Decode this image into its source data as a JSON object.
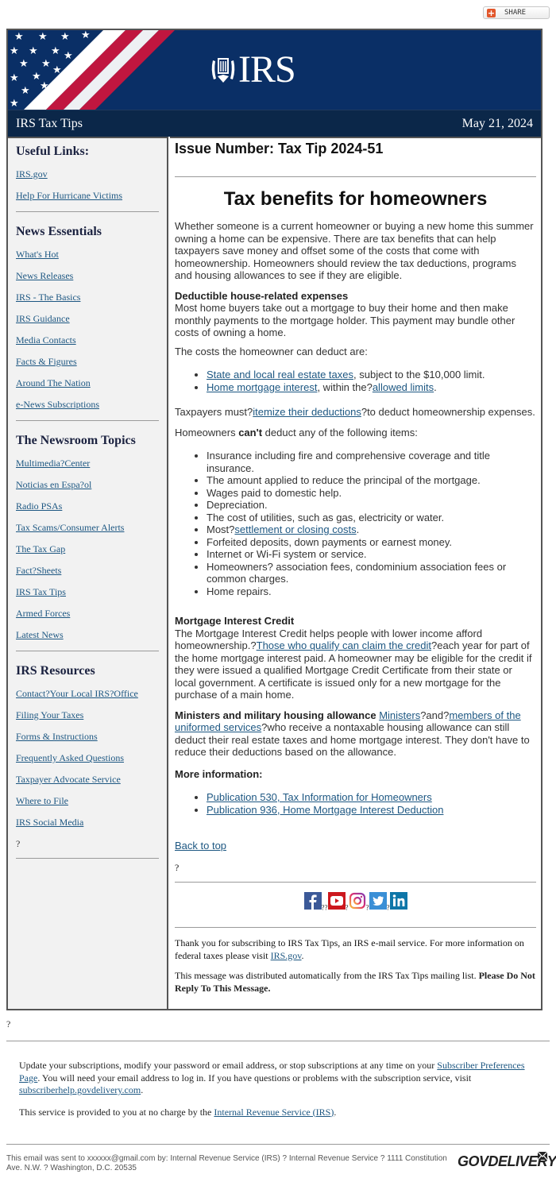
{
  "share": {
    "label": "SHARE",
    "icon": "plus-icon"
  },
  "banner": {
    "logo_text": "IRS",
    "logo_icon": "irs-eagle-seal-icon"
  },
  "titlebar": {
    "left": "IRS Tax Tips",
    "right": "May 21, 2024"
  },
  "sidebar": {
    "sections": [
      {
        "title": "Useful Links:",
        "links": [
          "IRS.gov",
          "Help For Hurricane Victims"
        ]
      },
      {
        "title": "News Essentials",
        "links": [
          "What's Hot",
          "News Releases",
          "IRS - The Basics",
          "IRS Guidance",
          "Media Contacts",
          "Facts & Figures",
          "Around The Nation",
          "e-News Subscriptions"
        ]
      },
      {
        "title": "The Newsroom Topics",
        "links": [
          "Multimedia?Center",
          "Noticias en Espa?ol",
          "Radio PSAs",
          "Tax Scams/Consumer Alerts",
          "The Tax Gap",
          "Fact?Sheets",
          "IRS Tax Tips",
          "Armed Forces",
          "Latest News"
        ]
      },
      {
        "title": "IRS Resources",
        "links": [
          "Contact?Your Local IRS?Office",
          "Filing Your Taxes",
          "Forms & Instructions",
          "Frequently Asked Questions",
          "Taxpayer Advocate Service",
          "Where to File",
          "IRS Social Media"
        ],
        "trailing": "?"
      }
    ]
  },
  "main": {
    "issue": "Issue Number: Tax Tip 2024-51",
    "headline": "Tax benefits for homeowners",
    "intro": "Whether someone is a current homeowner or buying a new home this summer owning a home can be expensive. There are tax benefits that can help taxpayers save money and offset some of the costs that come with homeownership. Homeowners should review the tax deductions, programs and housing allowances to see if they are eligible.",
    "deductible": {
      "heading": "Deductible house-related expenses",
      "body": "Most home buyers take out a mortgage to buy their home and then make monthly payments to the mortgage holder. This payment may bundle other costs of owning a home.",
      "lead": "The costs the homeowner can deduct are:",
      "item1_link": "State and local real estate taxes",
      "item1_rest": ", subject to the $10,000 limit.",
      "item2_link": "Home mortgage interest",
      "item2_mid": ", within the?",
      "item2_link2": "allowed limits",
      "item2_end": "."
    },
    "itemize": {
      "pre": "Taxpayers must?",
      "link": "itemize their deductions",
      "post": "?to deduct homeownership expenses."
    },
    "cant": {
      "pre": "Homeowners ",
      "bold": "can't",
      "post": " deduct any of the following items:",
      "items": [
        "Insurance including fire and comprehensive coverage and title insurance.",
        "The amount applied to reduce the principal of the mortgage.",
        "Wages paid to domestic help.",
        "Depreciation.",
        "The cost of utilities, such as gas, electricity or water."
      ],
      "most_pre": "Most?",
      "most_link": "settlement or closing costs",
      "most_post": ".",
      "items_after": [
        "Forfeited deposits, down payments or earnest money.",
        "Internet or Wi-Fi system or service.",
        "Homeowners? association fees, condominium association fees or common charges.",
        "Home repairs."
      ]
    },
    "mic": {
      "heading": "Mortgage Interest Credit",
      "pre": "The Mortgage Interest Credit helps people with lower income afford homeownership.?",
      "link": "Those who qualify can claim the credit",
      "post": "?each year for part of the home mortgage interest paid. A homeowner may be eligible for the credit if they were issued a qualified Mortgage Credit Certificate from their state or local government. A certificate is issued only for a new mortgage for the purchase of a main home."
    },
    "ministers": {
      "heading": "Ministers and military housing allowance",
      "link1": "Ministers",
      "mid": "?and?",
      "link2": "members of the uniformed services",
      "post": "?who receive a nontaxable housing allowance can still deduct their real estate taxes and home mortgage interest. They don't have to reduce their deductions based on the allowance."
    },
    "more": {
      "heading": "More information:",
      "links": [
        "Publication 530, Tax Information for Homeowners",
        "Publication 936, Home Mortgage Interest Deduction"
      ]
    },
    "back_to_top": "Back to top",
    "stray_q": "?",
    "social": {
      "icons": [
        "facebook-icon",
        "youtube-icon",
        "instagram-icon",
        "twitter-icon",
        "linkedin-icon"
      ],
      "separators": [
        "??",
        "?",
        "?",
        "?"
      ]
    },
    "footer": {
      "thanks_pre": "Thank you for subscribing to IRS Tax Tips, an IRS e-mail service. For more information on federal taxes please visit ",
      "thanks_link": "IRS.gov",
      "thanks_post": ".",
      "auto_pre": "This message was distributed automatically from the IRS Tax Tips mailing list. ",
      "auto_bold": "Please Do Not Reply To This Message."
    }
  },
  "outer": {
    "stray_q": "?",
    "prefs_pre": "Update your subscriptions, modify your password or email address, or stop subscriptions at any time on your ",
    "prefs_link": "Subscriber Preferences Page",
    "prefs_mid": ". You will need your email address to log in. If you have questions or problems with the subscription service, visit ",
    "prefs_link2": "subscriberhelp.govdelivery.com",
    "prefs_end": ".",
    "service_pre": "This service is provided to you at no charge by the ",
    "service_link": "Internal Revenue Service (IRS)",
    "service_end": ".",
    "sent": "This email was sent to xxxxxx@gmail.com by: Internal Revenue Service (IRS) ? Internal Revenue Service ? 1111 Constitution Ave. N.W. ? Washington, D.C. 20535",
    "govdelivery": "GOVDELIVERY"
  },
  "colors": {
    "banner_navy": "#0a2f66",
    "titlebar_navy": "#0b2749",
    "link": "#1d5782",
    "flag_red": "#c0163f",
    "sidebar_bg": "#f2f2f2"
  }
}
